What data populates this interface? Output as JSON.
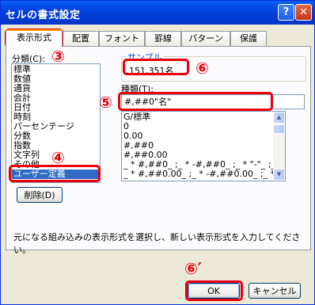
{
  "window": {
    "title": "セルの書式設定",
    "help_glyph": "?",
    "close_glyph": "✕"
  },
  "tabs": [
    "表示形式",
    "配置",
    "フォント",
    "罫線",
    "パターン",
    "保護"
  ],
  "category": {
    "label": "分類(C):",
    "items": [
      "標準",
      "数値",
      "通貨",
      "会計",
      "日付",
      "時刻",
      "パーセンテージ",
      "分数",
      "指数",
      "文字列",
      "その他",
      "ユーザー定義"
    ],
    "selected": "ユーザー定義"
  },
  "sample": {
    "group_label": "サンプル",
    "value": "151,351名"
  },
  "type": {
    "label": "種類(T):",
    "input_value": "#,##0\"名\"",
    "items": [
      "G/標準",
      "0",
      "0.00",
      "#,##0",
      "#,##0.00",
      "_ * #,##0_ ;_ * -#,##0_ ;_ * \"-\"_ ;_ @",
      "_ * #,##0.00_ ;_ * -#,##0.00_ ;_ * \"-\"??"
    ]
  },
  "delete_button": "削除(D)",
  "description": "元になる組み込みの表示形式を選択し、新しい表示形式を入力してください。",
  "ok_button": "OK",
  "cancel_button": "キャンセル",
  "annotations": {
    "n3": "③",
    "n4": "④",
    "n5": "⑤",
    "n6": "⑥",
    "n6p": "⑥′"
  },
  "colors": {
    "annotation": "#e8000b",
    "selection": "#316ac5",
    "titlebar": "#0a5ef5"
  }
}
